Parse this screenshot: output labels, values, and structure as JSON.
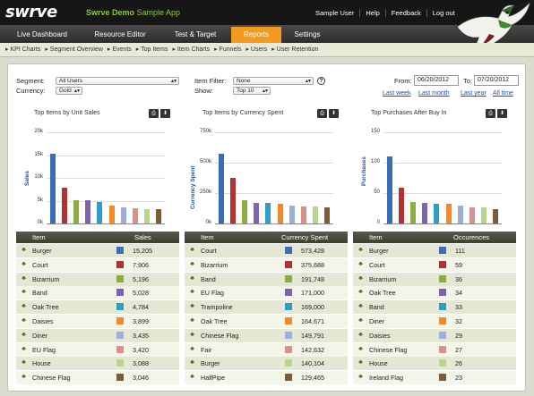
{
  "header": {
    "logo": "swrve",
    "app_name_bold": "Swrve Demo",
    "app_name_rest": " Sample App",
    "links": [
      "Sample User",
      "Help",
      "Feedback",
      "Log out"
    ]
  },
  "nav": {
    "tabs": [
      "Live Dashboard",
      "Resource Editor",
      "Test & Target",
      "Reports",
      "Settings"
    ],
    "active": "Reports"
  },
  "subnav": [
    "▸ KPI Charts",
    "▸ Segment Overview",
    "▸ Events",
    "▸ Top Items",
    "▸ Item Charts",
    "▸ Funnels",
    "▸ Users",
    "▸ User Retention"
  ],
  "filters": {
    "segment_label": "Segment:",
    "segment_value": "All Users",
    "currency_label": "Currency:",
    "currency_value": "Gold",
    "item_filter_label": "Item Filter:",
    "item_filter_value": "None",
    "show_label": "Show:",
    "show_value": "Top 10",
    "from_label": "From:",
    "from_value": "06/20/2012",
    "to_label": "To:",
    "to_value": "07/20/2012",
    "quick_ranges": [
      "Last week",
      "Last month",
      "Last year",
      "All time"
    ]
  },
  "colors": [
    "#3a6db5",
    "#b03232",
    "#8cae3e",
    "#7e63b0",
    "#2f9ec2",
    "#ef8a2a",
    "#9bb1d9",
    "#d9918e",
    "#b8d58a",
    "#7d5c3c"
  ],
  "charts": [
    {
      "title": "Top Items by Unit Sales",
      "ylabel": "Sales",
      "ticks": [
        "20k",
        "15k",
        "10k",
        "5k",
        "0k"
      ],
      "max": 20000,
      "values": [
        15205,
        7906,
        5196,
        5028,
        4784,
        3899,
        3435,
        3420,
        3088,
        3046
      ],
      "col_item": "Item",
      "col_value": "Sales",
      "items": [
        "Burger",
        "Court",
        "Bizarrium",
        "Band",
        "Oak Tree",
        "Daisies",
        "Diner",
        "EU Flag",
        "House",
        "Chinese Flag"
      ],
      "labels": [
        "15,205",
        "7,906",
        "5,196",
        "5,028",
        "4,784",
        "3,899",
        "3,435",
        "3,420",
        "3,088",
        "3,046"
      ],
      "color_idx": [
        0,
        1,
        2,
        3,
        4,
        5,
        6,
        7,
        8,
        9
      ]
    },
    {
      "title": "Top Items by Currency Spent",
      "ylabel": "Currency Spent",
      "ticks": [
        "750k",
        "500k",
        "250k",
        "0k"
      ],
      "max": 750000,
      "values": [
        573428,
        375688,
        191748,
        171000,
        169000,
        164671,
        149791,
        142632,
        140104,
        129465
      ],
      "col_item": "Item",
      "col_value": "Currency Spent",
      "items": [
        "Court",
        "Bizarrium",
        "Band",
        "EU Flag",
        "Trampoline",
        "Oak Tree",
        "Chinese Flag",
        "Fair",
        "Burger",
        "HalfPipe"
      ],
      "labels": [
        "573,428",
        "375,688",
        "191,748",
        "171,000",
        "169,000",
        "164,671",
        "149,791",
        "142,632",
        "140,104",
        "129,465"
      ],
      "color_idx": [
        0,
        1,
        2,
        3,
        4,
        5,
        6,
        7,
        8,
        9
      ]
    },
    {
      "title": "Top Purchases After Buy In",
      "ylabel": "Purchases",
      "ticks": [
        "150",
        "100",
        "50",
        "0"
      ],
      "max": 150,
      "values": [
        111,
        59,
        36,
        34,
        33,
        32,
        29,
        27,
        26,
        23
      ],
      "col_item": "Item",
      "col_value": "Occurences",
      "items": [
        "Burger",
        "Court",
        "Bizarrium",
        "Oak Tree",
        "Band",
        "Diner",
        "Daisies",
        "Chinese Flag",
        "House",
        "Ireland Flag"
      ],
      "labels": [
        "111",
        "59",
        "36",
        "34",
        "33",
        "32",
        "29",
        "27",
        "26",
        "23"
      ],
      "color_idx": [
        0,
        1,
        2,
        3,
        4,
        5,
        6,
        7,
        8,
        9
      ]
    }
  ],
  "icons": [
    "print-icon",
    "download-icon",
    "item-icon",
    "help-icon",
    "dropdown-arrow-icon",
    "hummingbird-logo"
  ]
}
